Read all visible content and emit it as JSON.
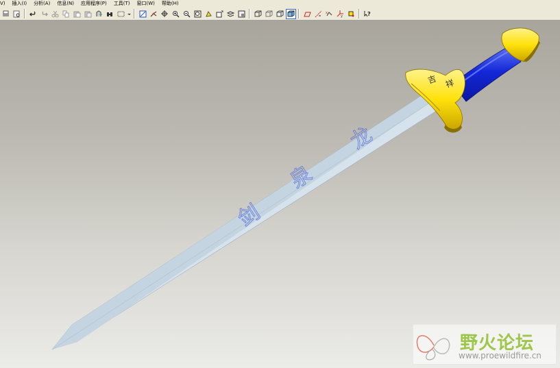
{
  "menu": {
    "items": [
      {
        "label": "V)"
      },
      {
        "label": "插入(I)"
      },
      {
        "label": "分析(A)"
      },
      {
        "label": "信息(N)"
      },
      {
        "label": "应用程序(P)"
      },
      {
        "label": "工具(T)"
      },
      {
        "label": "窗口(W)"
      },
      {
        "label": "帮助(H)"
      }
    ]
  },
  "toolbar": {
    "buttons": [
      {
        "name": "print-icon"
      },
      {
        "name": "print-preview-icon"
      },
      {
        "name": "undo-icon"
      },
      {
        "name": "redo-icon"
      },
      {
        "name": "cut-icon"
      },
      {
        "name": "copy-icon"
      },
      {
        "name": "paste-icon"
      },
      {
        "name": "paste-special-icon"
      },
      {
        "name": "regenerate-icon"
      },
      {
        "name": "find-icon"
      },
      {
        "name": "select-box-icon"
      },
      {
        "name": "redraw-icon"
      },
      {
        "name": "spin-center-icon"
      },
      {
        "name": "orient-icon"
      },
      {
        "name": "zoom-in-icon"
      },
      {
        "name": "zoom-out-icon"
      },
      {
        "name": "refit-icon"
      },
      {
        "name": "reorient-icon"
      },
      {
        "name": "saved-views-icon"
      },
      {
        "name": "layers-icon"
      },
      {
        "name": "model-display-icon"
      },
      {
        "name": "wireframe-icon"
      },
      {
        "name": "hidden-line-icon"
      },
      {
        "name": "no-hidden-icon"
      },
      {
        "name": "shading-icon"
      },
      {
        "name": "datum-planes-icon"
      },
      {
        "name": "datum-axes-icon"
      },
      {
        "name": "datum-points-icon"
      },
      {
        "name": "coordinate-systems-icon"
      },
      {
        "name": "spin-center-display-icon"
      },
      {
        "name": "context-help-icon"
      }
    ]
  },
  "model": {
    "blade_engraving": [
      "龙",
      "泉",
      "剑"
    ],
    "guard_engraving": [
      "吉",
      "祥"
    ],
    "colors": {
      "blade": "#d3e0ea",
      "blade_shade": "#b8cbd8",
      "engraving": "#6a7fd8",
      "guard": "#ffe10a",
      "guard_shade": "#c8a800",
      "grip": "#1326d6",
      "grip_highlight": "#4a62f0"
    }
  },
  "watermark": {
    "title": "野火论坛",
    "url": "www.proewildfire.cn"
  }
}
